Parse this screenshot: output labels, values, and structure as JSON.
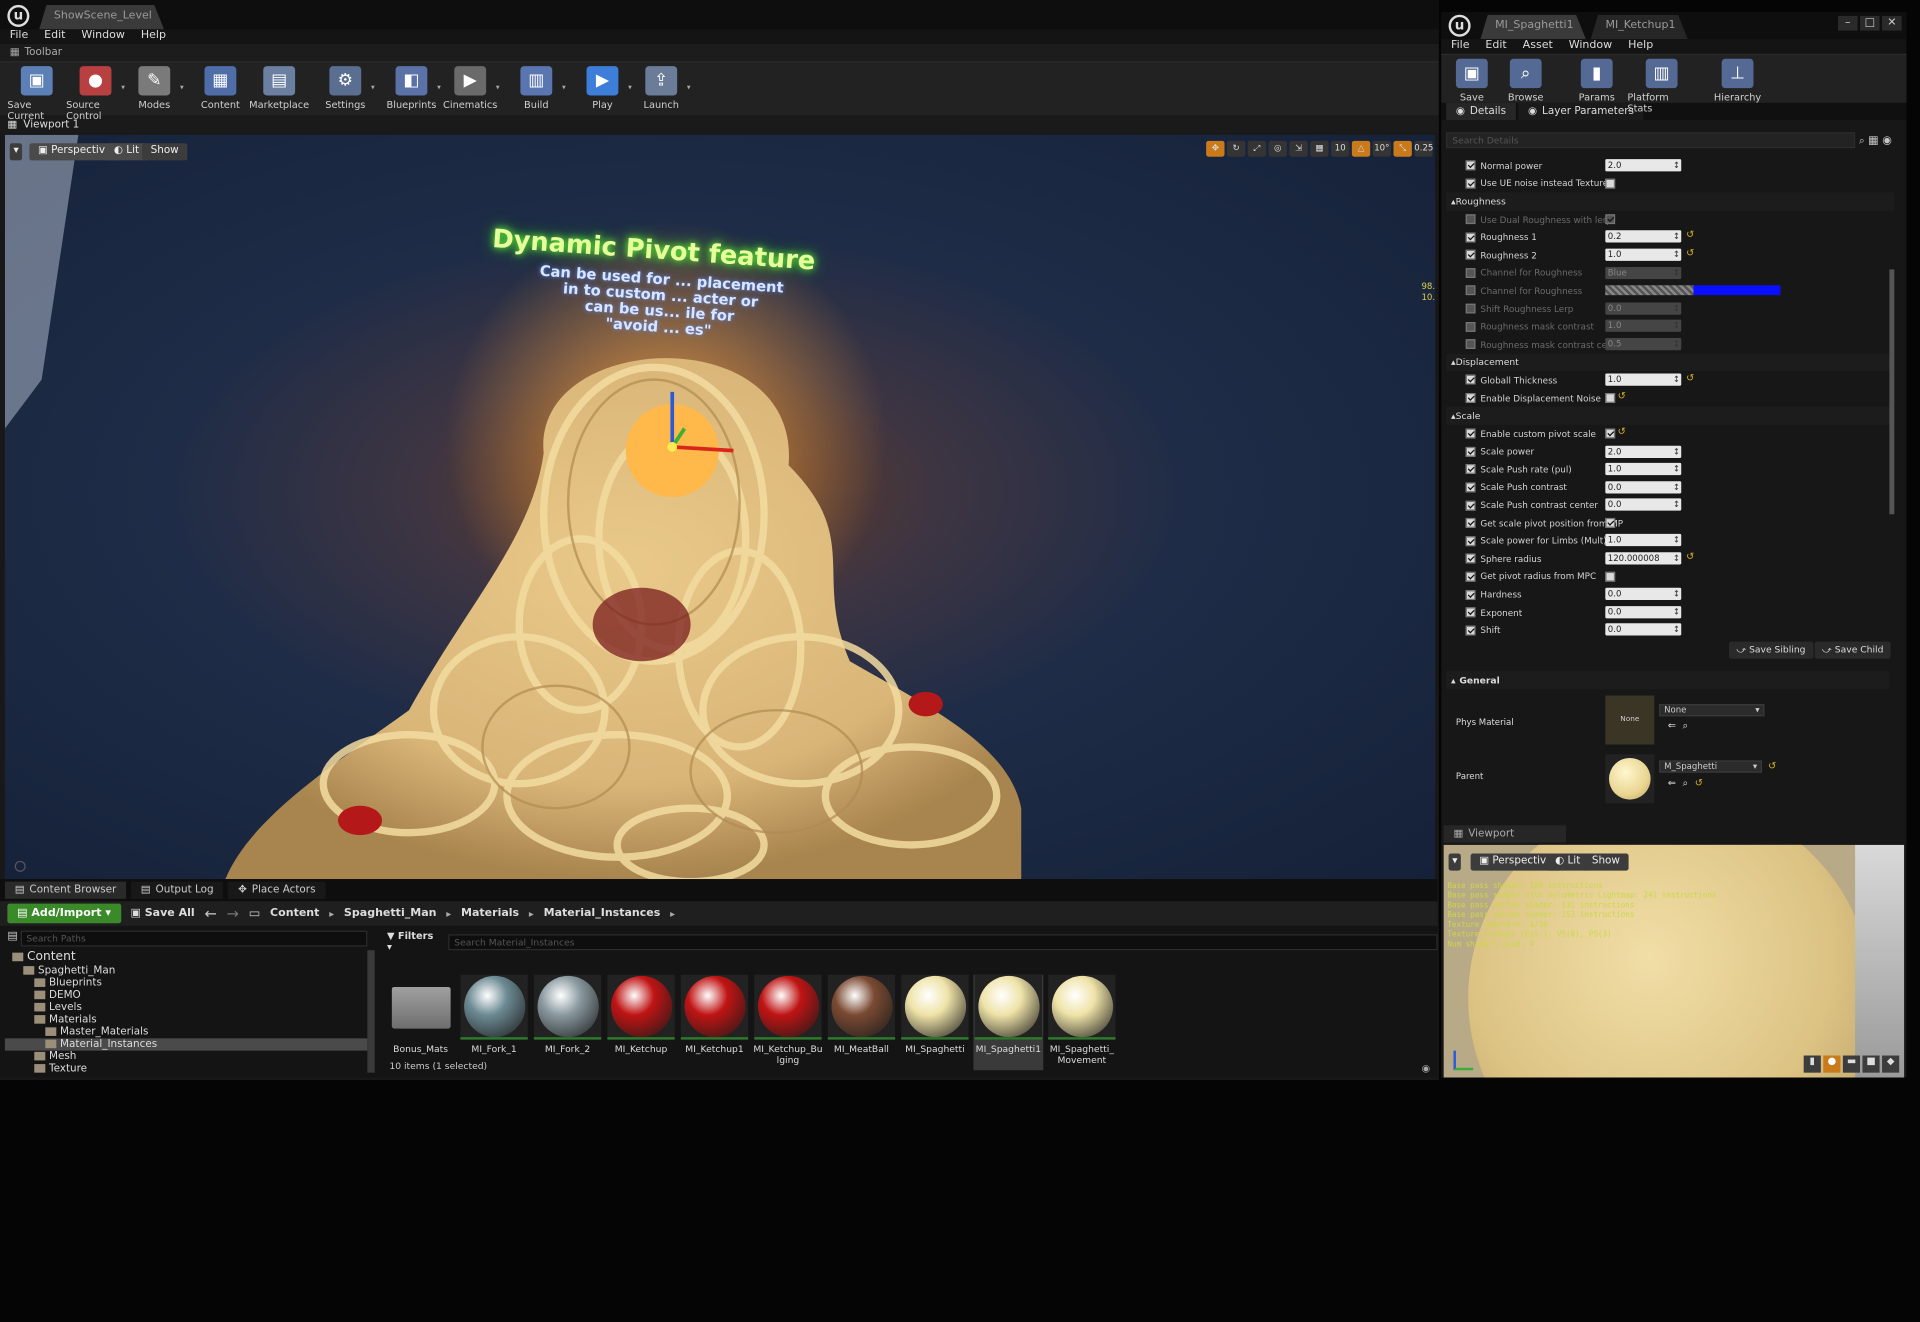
{
  "main": {
    "doc_tab": "ShowScene_Level",
    "menu": [
      "File",
      "Edit",
      "Window",
      "Help"
    ],
    "toolbar_label": "Toolbar",
    "toolbar": [
      {
        "label": "Save Current",
        "icon": "save-icon",
        "color": "#5c7fb6"
      },
      {
        "label": "Source Control",
        "icon": "source-control-icon",
        "color": "#b94040"
      },
      {
        "label": "Modes",
        "icon": "modes-icon",
        "color": "#7a7a7a"
      },
      {
        "label": "Content",
        "icon": "content-icon",
        "color": "#4f6ea8"
      },
      {
        "label": "Marketplace",
        "icon": "marketplace-icon",
        "color": "#6b7fa0"
      },
      {
        "label": "Settings",
        "icon": "settings-icon",
        "color": "#5a6e92"
      },
      {
        "label": "Blueprints",
        "icon": "blueprints-icon",
        "color": "#5a72a8"
      },
      {
        "label": "Cinematics",
        "icon": "cinematics-icon",
        "color": "#6a6a6a"
      },
      {
        "label": "Build",
        "icon": "build-icon",
        "color": "#5a76b0"
      },
      {
        "label": "Play",
        "icon": "play-icon",
        "color": "#3d7ed8"
      },
      {
        "label": "Launch",
        "icon": "launch-icon",
        "color": "#6a7c98"
      }
    ],
    "viewport_tab": "Viewport 1",
    "viewport_buttons": {
      "perspective": "Perspective",
      "lit": "Lit",
      "show": "Show"
    },
    "snap_values": [
      "10",
      "10°",
      "0.25"
    ],
    "overlay_title": "Dynamic Pivot feature",
    "overlay_lines": [
      "Can be used for ... placement",
      "in to custom ... acter or",
      "can be us... ile for",
      "\"avoid ... es\""
    ],
    "stats_side": [
      "98.",
      "10."
    ]
  },
  "content_browser": {
    "tabs": [
      "Content Browser",
      "Output Log",
      "Place Actors"
    ],
    "add_import": "Add/Import",
    "save_all": "Save All",
    "breadcrumb": [
      "Content",
      "Spaghetti_Man",
      "Materials",
      "Material_Instances"
    ],
    "search_paths_placeholder": "Search Paths",
    "filters": "Filters",
    "search_placeholder": "Search Material_Instances",
    "tree": [
      {
        "label": "Content",
        "indent": 0,
        "selected": false
      },
      {
        "label": "Spaghetti_Man",
        "indent": 1,
        "selected": false
      },
      {
        "label": "Blueprints",
        "indent": 2,
        "selected": false
      },
      {
        "label": "DEMO",
        "indent": 2,
        "selected": false
      },
      {
        "label": "Levels",
        "indent": 2,
        "selected": false
      },
      {
        "label": "Materials",
        "indent": 2,
        "selected": false
      },
      {
        "label": "Master_Materials",
        "indent": 3,
        "selected": false
      },
      {
        "label": "Material_Instances",
        "indent": 3,
        "selected": true
      },
      {
        "label": "Mesh",
        "indent": 2,
        "selected": false
      },
      {
        "label": "Texture",
        "indent": 2,
        "selected": false
      }
    ],
    "assets": [
      {
        "label": "Bonus_Mats",
        "kind": "folder",
        "color": "#888888"
      },
      {
        "label": "MI_Fork_1",
        "kind": "ball",
        "color": "#6c8a93"
      },
      {
        "label": "MI_Fork_2",
        "kind": "ball",
        "color": "#8a9aa0"
      },
      {
        "label": "MI_Ketchup",
        "kind": "ball",
        "color": "#c01414"
      },
      {
        "label": "MI_Ketchup1",
        "kind": "ball",
        "color": "#c01414"
      },
      {
        "label": "MI_Ketchup_Bulging",
        "kind": "ball",
        "color": "#c01414"
      },
      {
        "label": "MI_MeatBall",
        "kind": "ball",
        "color": "#7a4a32"
      },
      {
        "label": "MI_Spaghetti",
        "kind": "ball",
        "color": "#efe3a8"
      },
      {
        "label": "MI_Spaghetti1",
        "kind": "ball",
        "color": "#efe3a8"
      },
      {
        "label": "MI_Spaghetti_Movement",
        "kind": "ball",
        "color": "#efe3a8"
      }
    ],
    "status": "10 items (1 selected)"
  },
  "material_editor": {
    "tabs": [
      "MI_Spaghetti1",
      "MI_Ketchup1"
    ],
    "menu": [
      "File",
      "Edit",
      "Asset",
      "Window",
      "Help"
    ],
    "toolbar": [
      {
        "label": "Save",
        "icon": "save-icon"
      },
      {
        "label": "Browse",
        "icon": "browse-icon"
      },
      {
        "label": "Params",
        "icon": "params-icon"
      },
      {
        "label": "Platform Stats",
        "icon": "platform-stats-icon"
      },
      {
        "label": "Hierarchy",
        "icon": "hierarchy-icon"
      }
    ],
    "panel_tabs": [
      "Details",
      "Layer Parameters"
    ],
    "search_placeholder": "Search Details",
    "rows": [
      {
        "type": "param",
        "label": "Normal power",
        "on": true,
        "value": "2.0",
        "kind": "num",
        "reset": false,
        "grey": false
      },
      {
        "type": "param",
        "label": "Use UE noise instead Texture",
        "on": true,
        "value": "",
        "kind": "bool",
        "bool": false,
        "reset": false,
        "grey": false
      },
      {
        "type": "section",
        "label": "Roughness"
      },
      {
        "type": "param",
        "label": "Use Dual Roughness with lerp",
        "on": false,
        "value": "",
        "kind": "bool",
        "bool": true,
        "reset": false,
        "grey": true
      },
      {
        "type": "param",
        "label": "Roughness 1",
        "on": true,
        "value": "0.2",
        "kind": "num",
        "reset": true,
        "grey": false
      },
      {
        "type": "param",
        "label": "Roughness 2",
        "on": true,
        "value": "1.0",
        "kind": "num",
        "reset": true,
        "grey": false
      },
      {
        "type": "param",
        "label": "Channel for Roughness",
        "on": false,
        "value": "Blue",
        "kind": "num",
        "reset": false,
        "grey": true
      },
      {
        "type": "param",
        "label": "Channel for Roughness",
        "on": false,
        "value": "",
        "kind": "color",
        "reset": false,
        "grey": true
      },
      {
        "type": "param",
        "label": "Shift Roughness Lerp",
        "on": false,
        "value": "0.0",
        "kind": "num",
        "reset": false,
        "grey": true
      },
      {
        "type": "param",
        "label": "Roughness mask contrast",
        "on": false,
        "value": "1.0",
        "kind": "num",
        "reset": false,
        "grey": true
      },
      {
        "type": "param",
        "label": "Roughness mask contrast cente",
        "on": false,
        "value": "0.5",
        "kind": "num",
        "reset": false,
        "grey": true
      },
      {
        "type": "section",
        "label": "Displacement"
      },
      {
        "type": "param",
        "label": "Globall Thickness",
        "on": true,
        "value": "1.0",
        "kind": "num",
        "reset": true,
        "grey": false
      },
      {
        "type": "param",
        "label": "Enable Displacement Noise",
        "on": true,
        "value": "",
        "kind": "bool",
        "bool": false,
        "reset": true,
        "grey": false
      },
      {
        "type": "section",
        "label": "Scale"
      },
      {
        "type": "param",
        "label": "Enable custom pivot scale",
        "on": true,
        "value": "",
        "kind": "bool",
        "bool": true,
        "reset": true,
        "grey": false
      },
      {
        "type": "param",
        "label": "Scale power",
        "on": true,
        "value": "2.0",
        "kind": "num",
        "reset": false,
        "grey": false
      },
      {
        "type": "param",
        "label": "Scale Push rate (pul)",
        "on": true,
        "value": "1.0",
        "kind": "num",
        "reset": false,
        "grey": false
      },
      {
        "type": "param",
        "label": "Scale Push contrast",
        "on": true,
        "value": "0.0",
        "kind": "num",
        "reset": false,
        "grey": false
      },
      {
        "type": "param",
        "label": "Scale Push contrast center",
        "on": true,
        "value": "0.0",
        "kind": "num",
        "reset": false,
        "grey": false
      },
      {
        "type": "param",
        "label": "Get scale pivot position from MP",
        "on": true,
        "value": "",
        "kind": "bool",
        "bool": true,
        "reset": false,
        "grey": false
      },
      {
        "type": "param",
        "label": "Scale power for Limbs (Mult)",
        "on": true,
        "value": "1.0",
        "kind": "num",
        "reset": false,
        "grey": false
      },
      {
        "type": "param",
        "label": "Sphere radius",
        "on": true,
        "value": "120.000008",
        "kind": "num",
        "reset": true,
        "grey": false
      },
      {
        "type": "param",
        "label": "Get pivot radius from MPC",
        "on": true,
        "value": "",
        "kind": "bool",
        "bool": false,
        "reset": false,
        "grey": false
      },
      {
        "type": "param",
        "label": "Hardness",
        "on": true,
        "value": "0.0",
        "kind": "num",
        "reset": false,
        "grey": false
      },
      {
        "type": "param",
        "label": "Exponent",
        "on": true,
        "value": "0.0",
        "kind": "num",
        "reset": false,
        "grey": false
      },
      {
        "type": "param",
        "label": "Shift",
        "on": true,
        "value": "0.0",
        "kind": "num",
        "reset": false,
        "grey": false
      }
    ],
    "save_sibling": "Save Sibling",
    "save_child": "Save Child",
    "general_label": "General",
    "phys_material_label": "Phys Material",
    "phys_material_thumb": "None",
    "phys_material_value": "None",
    "parent_label": "Parent",
    "parent_value": "M_Spaghetti",
    "viewport_tab": "Viewport",
    "viewport_buttons": {
      "perspective": "Perspective",
      "lit": "Lit",
      "show": "Show"
    },
    "stats": [
      "Base pass shader: 168 instructions",
      "Base pass shader with Volumetric Lightmap: 241 instructions",
      "Base pass vertex shader: 131 instructions",
      "Base pass vertex shader: 153 instructions",
      "Texture samplers: 4/16",
      "Texture Lookups (Est.): VS(0), PS(3)",
      "Num shaders used: 4"
    ]
  },
  "colors": {
    "accent_green": "#3b8a2a",
    "selection": "#4a4a4a",
    "reset_arrow": "#d8b31e"
  }
}
